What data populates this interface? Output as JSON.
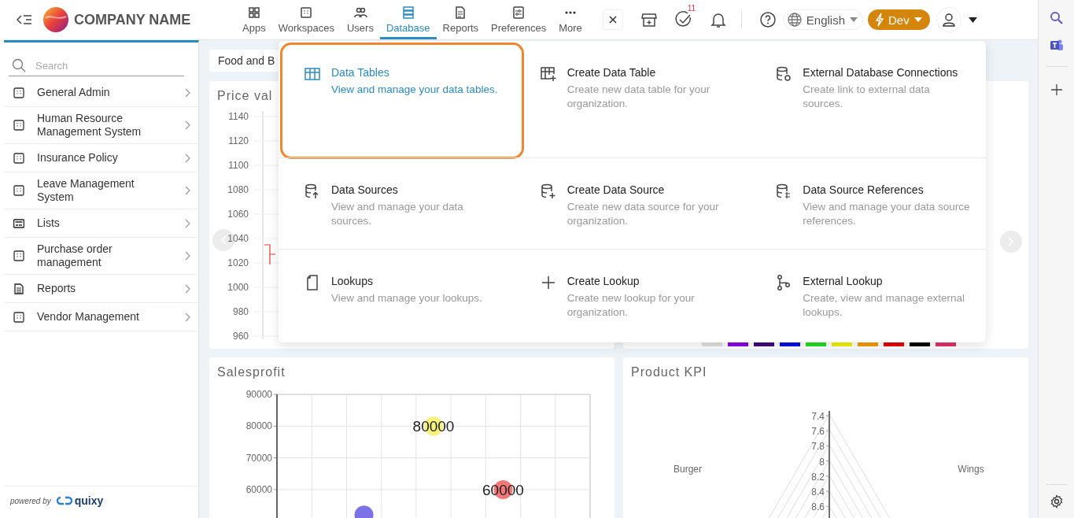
{
  "header": {
    "company_name": "COMPANY NAME",
    "nav": [
      {
        "label": "Apps",
        "kind": "apps",
        "selected": false
      },
      {
        "label": "Workspaces",
        "kind": "workspaces",
        "selected": false
      },
      {
        "label": "Users",
        "kind": "users",
        "selected": false
      },
      {
        "label": "Database",
        "kind": "database",
        "selected": true
      },
      {
        "label": "Reports",
        "kind": "reports",
        "selected": false
      },
      {
        "label": "Preferences",
        "kind": "preferences",
        "selected": false
      },
      {
        "label": "More",
        "kind": "more",
        "selected": false
      }
    ],
    "tasks_badge": "11",
    "language": "English",
    "environment": "Dev"
  },
  "sidebar": {
    "search": {
      "placeholder": "Search"
    },
    "items": [
      {
        "label": "General Admin",
        "kind": "grid"
      },
      {
        "label": "Human Resource Management System",
        "kind": "grid"
      },
      {
        "label": "Insurance Policy",
        "kind": "grid"
      },
      {
        "label": "Leave Management System",
        "kind": "grid"
      },
      {
        "label": "Lists",
        "kind": "list"
      },
      {
        "label": "Purchase order management",
        "kind": "grid"
      },
      {
        "label": "Reports",
        "kind": "document"
      },
      {
        "label": "Vendor Management",
        "kind": "grid"
      }
    ],
    "footer": {
      "powered_by": "powered by",
      "brand": "quixy"
    }
  },
  "content": {
    "tab": "Food and B",
    "price_chart": {
      "title": "Price val",
      "y_axis_labels": [
        "1140",
        "1120",
        "1100",
        "1080",
        "1060",
        "1040",
        "1020",
        "1000",
        "980",
        "960"
      ]
    },
    "legend_swatches": [
      {
        "color": "#e0e0e0"
      },
      {
        "color": "#8a00e6"
      },
      {
        "color": "#3d0a78"
      },
      {
        "color": "#0010e6"
      },
      {
        "color": "#22dd22"
      },
      {
        "color": "#f0f000"
      },
      {
        "color": "#f59a00"
      },
      {
        "color": "#e60000"
      },
      {
        "color": "#000000"
      },
      {
        "color": "#e0306a"
      }
    ],
    "salesprofit": {
      "chart_data": {
        "type": "scatter",
        "title": "Salesprofit",
        "categories": [
          null,
          null,
          null
        ],
        "ylim": [
          51000,
          90000
        ],
        "yticks": [
          60000,
          70000,
          80000,
          90000
        ],
        "grid": true,
        "value_labels": [
          [
            null,
            null,
            null
          ],
          [
            null,
            "80000",
            null
          ],
          [
            null,
            null,
            "60000"
          ]
        ],
        "series": [
          {
            "color": "#7a72e6",
            "values": [
              52000,
              null,
              null
            ]
          },
          {
            "color": "#f7f27a",
            "values": [
              null,
              80000,
              null
            ]
          },
          {
            "color": "#f07878",
            "values": [
              null,
              null,
              60000
            ]
          }
        ]
      }
    },
    "product_kpi": {
      "title": "Product KPI",
      "scale": [
        "7.4",
        "7.6",
        "7.8",
        "8",
        "8.2",
        "8.4",
        "8.6"
      ],
      "axes": [
        "Burger",
        "Wings"
      ]
    }
  },
  "database_menu": {
    "items": [
      {
        "title": "Data Tables",
        "description": "View and manage your data tables.",
        "kind": "table",
        "selected": true
      },
      {
        "title": "Create Data Table",
        "description": "Create new data table for your organization.",
        "kind": "table-add",
        "selected": false
      },
      {
        "title": "External Database Connections",
        "description": "Create link to external data sources.",
        "kind": "db-link",
        "selected": false
      },
      {
        "title": "Data Sources",
        "description": "View and manage your data sources.",
        "kind": "db-source",
        "selected": false
      },
      {
        "title": "Create Data Source",
        "description": "Create new data source for your organization.",
        "kind": "db-add",
        "selected": false
      },
      {
        "title": "Data Source References",
        "description": "View and manage your data source references.",
        "kind": "db-ref",
        "selected": false
      },
      {
        "title": "Lookups",
        "description": "View and manage your lookups.",
        "kind": "lookup",
        "selected": false
      },
      {
        "title": "Create Lookup",
        "description": "Create new lookup for your organization.",
        "kind": "add",
        "selected": false
      },
      {
        "title": "External Lookup",
        "description": "Create, view and manage external lookups.",
        "kind": "branch",
        "selected": false
      }
    ]
  }
}
